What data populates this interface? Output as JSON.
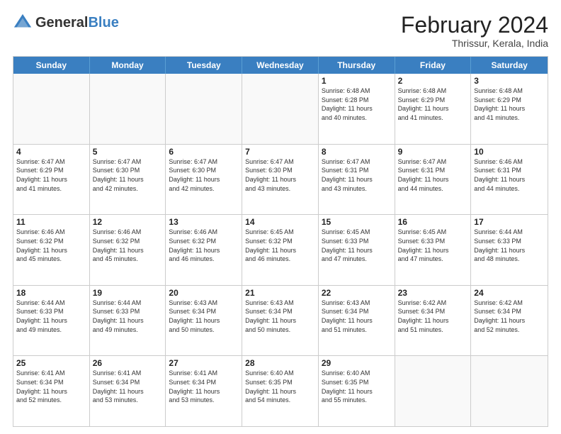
{
  "logo": {
    "general": "General",
    "blue": "Blue"
  },
  "title": "February 2024",
  "subtitle": "Thrissur, Kerala, India",
  "headers": [
    "Sunday",
    "Monday",
    "Tuesday",
    "Wednesday",
    "Thursday",
    "Friday",
    "Saturday"
  ],
  "weeks": [
    [
      {
        "day": "",
        "info": ""
      },
      {
        "day": "",
        "info": ""
      },
      {
        "day": "",
        "info": ""
      },
      {
        "day": "",
        "info": ""
      },
      {
        "day": "1",
        "info": "Sunrise: 6:48 AM\nSunset: 6:28 PM\nDaylight: 11 hours\nand 40 minutes."
      },
      {
        "day": "2",
        "info": "Sunrise: 6:48 AM\nSunset: 6:29 PM\nDaylight: 11 hours\nand 41 minutes."
      },
      {
        "day": "3",
        "info": "Sunrise: 6:48 AM\nSunset: 6:29 PM\nDaylight: 11 hours\nand 41 minutes."
      }
    ],
    [
      {
        "day": "4",
        "info": "Sunrise: 6:47 AM\nSunset: 6:29 PM\nDaylight: 11 hours\nand 41 minutes."
      },
      {
        "day": "5",
        "info": "Sunrise: 6:47 AM\nSunset: 6:30 PM\nDaylight: 11 hours\nand 42 minutes."
      },
      {
        "day": "6",
        "info": "Sunrise: 6:47 AM\nSunset: 6:30 PM\nDaylight: 11 hours\nand 42 minutes."
      },
      {
        "day": "7",
        "info": "Sunrise: 6:47 AM\nSunset: 6:30 PM\nDaylight: 11 hours\nand 43 minutes."
      },
      {
        "day": "8",
        "info": "Sunrise: 6:47 AM\nSunset: 6:31 PM\nDaylight: 11 hours\nand 43 minutes."
      },
      {
        "day": "9",
        "info": "Sunrise: 6:47 AM\nSunset: 6:31 PM\nDaylight: 11 hours\nand 44 minutes."
      },
      {
        "day": "10",
        "info": "Sunrise: 6:46 AM\nSunset: 6:31 PM\nDaylight: 11 hours\nand 44 minutes."
      }
    ],
    [
      {
        "day": "11",
        "info": "Sunrise: 6:46 AM\nSunset: 6:32 PM\nDaylight: 11 hours\nand 45 minutes."
      },
      {
        "day": "12",
        "info": "Sunrise: 6:46 AM\nSunset: 6:32 PM\nDaylight: 11 hours\nand 45 minutes."
      },
      {
        "day": "13",
        "info": "Sunrise: 6:46 AM\nSunset: 6:32 PM\nDaylight: 11 hours\nand 46 minutes."
      },
      {
        "day": "14",
        "info": "Sunrise: 6:45 AM\nSunset: 6:32 PM\nDaylight: 11 hours\nand 46 minutes."
      },
      {
        "day": "15",
        "info": "Sunrise: 6:45 AM\nSunset: 6:33 PM\nDaylight: 11 hours\nand 47 minutes."
      },
      {
        "day": "16",
        "info": "Sunrise: 6:45 AM\nSunset: 6:33 PM\nDaylight: 11 hours\nand 47 minutes."
      },
      {
        "day": "17",
        "info": "Sunrise: 6:44 AM\nSunset: 6:33 PM\nDaylight: 11 hours\nand 48 minutes."
      }
    ],
    [
      {
        "day": "18",
        "info": "Sunrise: 6:44 AM\nSunset: 6:33 PM\nDaylight: 11 hours\nand 49 minutes."
      },
      {
        "day": "19",
        "info": "Sunrise: 6:44 AM\nSunset: 6:33 PM\nDaylight: 11 hours\nand 49 minutes."
      },
      {
        "day": "20",
        "info": "Sunrise: 6:43 AM\nSunset: 6:34 PM\nDaylight: 11 hours\nand 50 minutes."
      },
      {
        "day": "21",
        "info": "Sunrise: 6:43 AM\nSunset: 6:34 PM\nDaylight: 11 hours\nand 50 minutes."
      },
      {
        "day": "22",
        "info": "Sunrise: 6:43 AM\nSunset: 6:34 PM\nDaylight: 11 hours\nand 51 minutes."
      },
      {
        "day": "23",
        "info": "Sunrise: 6:42 AM\nSunset: 6:34 PM\nDaylight: 11 hours\nand 51 minutes."
      },
      {
        "day": "24",
        "info": "Sunrise: 6:42 AM\nSunset: 6:34 PM\nDaylight: 11 hours\nand 52 minutes."
      }
    ],
    [
      {
        "day": "25",
        "info": "Sunrise: 6:41 AM\nSunset: 6:34 PM\nDaylight: 11 hours\nand 52 minutes."
      },
      {
        "day": "26",
        "info": "Sunrise: 6:41 AM\nSunset: 6:34 PM\nDaylight: 11 hours\nand 53 minutes."
      },
      {
        "day": "27",
        "info": "Sunrise: 6:41 AM\nSunset: 6:34 PM\nDaylight: 11 hours\nand 53 minutes."
      },
      {
        "day": "28",
        "info": "Sunrise: 6:40 AM\nSunset: 6:35 PM\nDaylight: 11 hours\nand 54 minutes."
      },
      {
        "day": "29",
        "info": "Sunrise: 6:40 AM\nSunset: 6:35 PM\nDaylight: 11 hours\nand 55 minutes."
      },
      {
        "day": "",
        "info": ""
      },
      {
        "day": "",
        "info": ""
      }
    ]
  ]
}
